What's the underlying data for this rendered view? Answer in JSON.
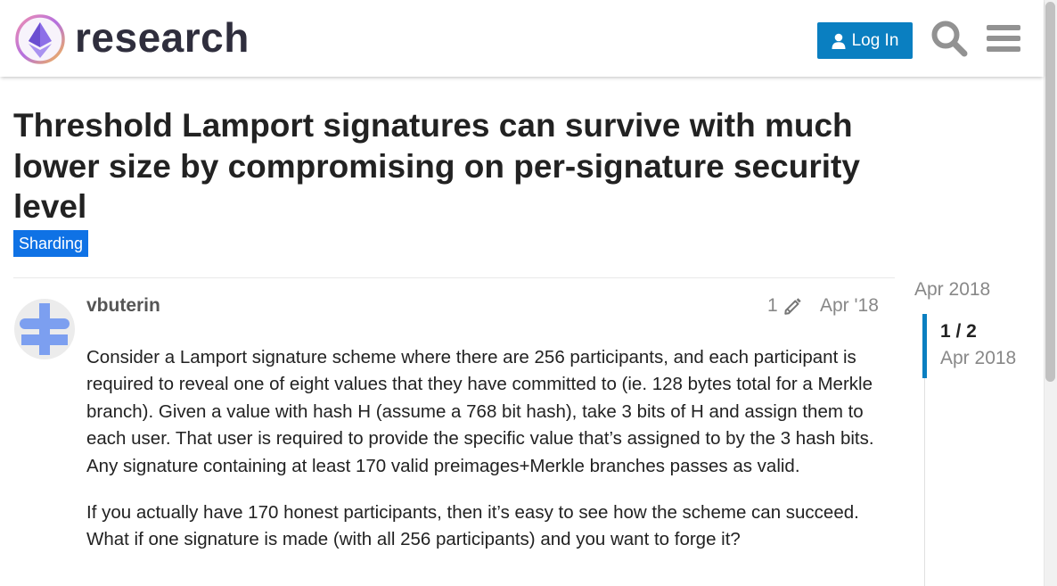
{
  "header": {
    "logo_text": "research",
    "login_label": "Log In"
  },
  "topic": {
    "title": "Threshold Lamport signatures can survive with much lower size by compromising on per-signature security level",
    "category": "Sharding",
    "category_color": "#0f72e5"
  },
  "post": {
    "username": "vbuterin",
    "edit_count": "1",
    "date": "Apr '18",
    "paragraphs": [
      "Consider a Lamport signature scheme where there are 256 participants, and each participant is required to reveal one of eight values that they have committed to (ie. 128 bytes total for a Merkle branch). Given a value with hash H (assume a 768 bit hash), take 3 bits of H and assign them to each user. That user is required to provide the specific value that’s assigned to by the 3 hash bits. Any signature containing at least 170 valid preimages+Merkle branches passes as valid.",
      "If you actually have 170 honest participants, then it’s easy to see how the scheme can succeed. What if one signature is made (with all 256 participants) and you want to forge it?"
    ]
  },
  "timeline": {
    "top_date": "Apr 2018",
    "position": "1 / 2",
    "current_date": "Apr 2018"
  },
  "colors": {
    "accent": "#0a7fc1",
    "text": "#222222",
    "muted": "#888888"
  }
}
